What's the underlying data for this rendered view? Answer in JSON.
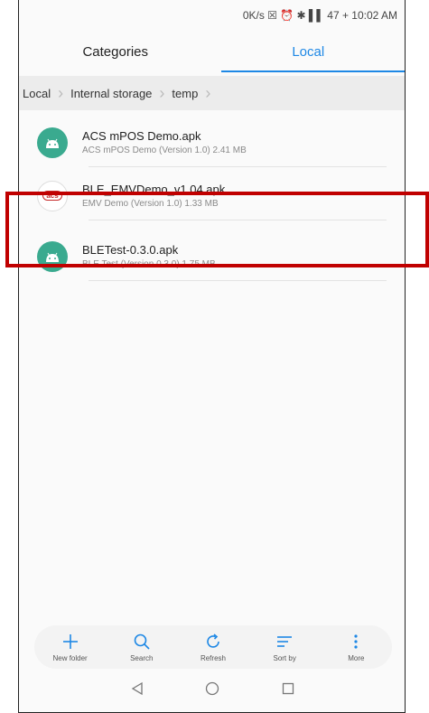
{
  "status_bar": {
    "text": "0K/s ☒ ⏰ ✱ ▌▌ 47 + 10:02 AM"
  },
  "tabs": [
    {
      "label": "Categories",
      "active": false
    },
    {
      "label": "Local",
      "active": true
    }
  ],
  "breadcrumb": [
    "Local",
    "Internal storage",
    "temp"
  ],
  "files": [
    {
      "name": "ACS mPOS Demo.apk",
      "desc": "ACS mPOS Demo (Version 1.0) 2.41 MB",
      "icon": "android-icon"
    },
    {
      "name": "BLE_EMVDemo_v1.04.apk",
      "desc": "EMV Demo (Version 1.0) 1.33 MB",
      "icon": "acs-icon",
      "badge": "acs"
    },
    {
      "name": "BLETest-0.3.0.apk",
      "desc": "BLE Test (Version 0.3.0) 1.75 MB",
      "icon": "android-icon"
    }
  ],
  "toolbar": [
    {
      "label": "New folder",
      "icon": "plus-icon"
    },
    {
      "label": "Search",
      "icon": "search-icon"
    },
    {
      "label": "Refresh",
      "icon": "refresh-icon"
    },
    {
      "label": "Sort by",
      "icon": "sort-icon"
    },
    {
      "label": "More",
      "icon": "more-icon"
    }
  ],
  "colors": {
    "accent": "#1e88e5",
    "highlight": "#c00000",
    "android": "#3aaa8f"
  }
}
